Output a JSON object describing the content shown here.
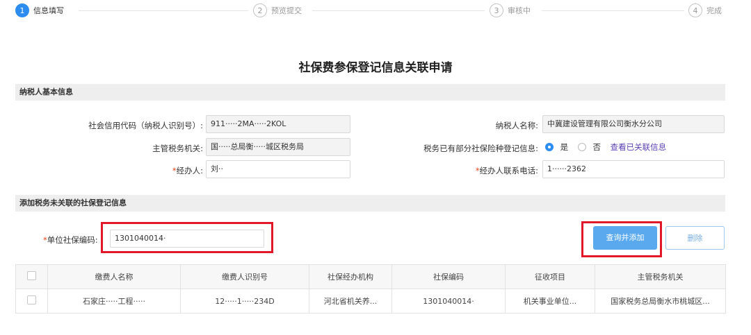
{
  "steps": [
    {
      "num": "1",
      "label": "信息填写"
    },
    {
      "num": "2",
      "label": "预览提交"
    },
    {
      "num": "3",
      "label": "审核中"
    },
    {
      "num": "4",
      "label": "完成"
    }
  ],
  "title": "社保费参保登记信息关联申请",
  "section1": {
    "header": "纳税人基本信息",
    "credit_code_label": "社会信用代码（纳税人识别号）:",
    "credit_code_value": "911·····2MA·····2KOL",
    "taxpayer_name_label": "纳税人名称:",
    "taxpayer_name_value": "中冀建设管理有限公司衡水分公司",
    "tax_authority_label": "主管税务机关:",
    "tax_authority_value": "国·····总局衡·····城区税务局",
    "registered_label": "税务已有部分社保险种登记信息:",
    "radio_yes": "是",
    "radio_no": "否",
    "view_link": "查看已关联信息",
    "agent_label": "经办人:",
    "agent_value": "刘··",
    "agent_phone_label": "经办人联系电话:",
    "agent_phone_value": "1······2362"
  },
  "section2": {
    "header": "添加税务未关联的社保登记信息",
    "unit_code_label": "单位社保编码:",
    "unit_code_value": "1301040014·",
    "query_add_btn": "查询并添加",
    "delete_btn": "删除"
  },
  "table": {
    "headers": [
      "缴费人名称",
      "缴费人识别号",
      "社保经办机构",
      "社保编码",
      "征收项目",
      "主管税务机关"
    ],
    "rows": [
      [
        "石家庄·····工程·····",
        "12·····1·····234D",
        "河北省机关养...",
        "1301040014·",
        "机关事业单位...",
        "国家税务总局衡水市桃城区..."
      ]
    ]
  },
  "colors": {
    "primary": "#2d8cf0",
    "highlight": "#e0182a",
    "required": "#ed4014"
  }
}
